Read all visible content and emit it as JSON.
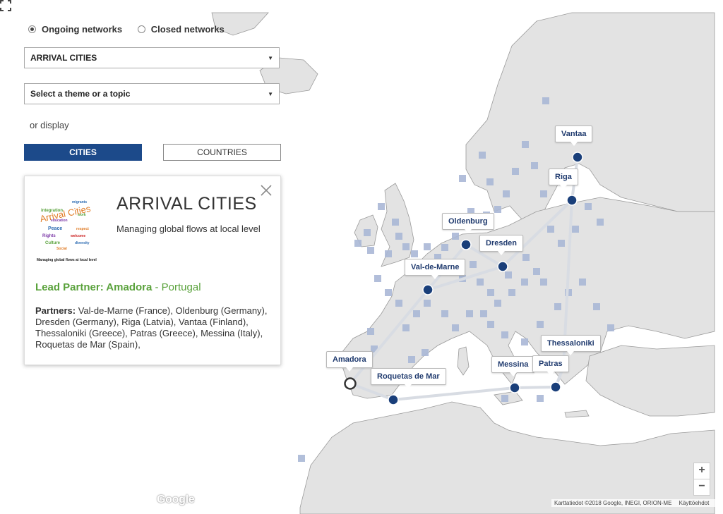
{
  "filters": {
    "network_options": [
      "Ongoing networks",
      "Closed networks"
    ],
    "selected_network": "Ongoing networks",
    "network_select_value": "ARRIVAL CITIES",
    "theme_select_placeholder": "Select a theme or a topic",
    "or_display": "or display",
    "cities_button": "CITIES",
    "countries_button": "COUNTRIES",
    "active_display": "CITIES"
  },
  "info_card": {
    "logo_text": "Arrival Cities",
    "logo_caption": "Managing global flows at local level",
    "title": "ARRIVAL CITIES",
    "subtitle": "Managing global flows at local level",
    "lead_label": "Lead Partner: Amadora",
    "lead_separator": "-",
    "lead_country": "Portugal",
    "partners_label": "Partners:",
    "partners_text": "Val-de-Marne (France), Oldenburg (Germany), Dresden (Germany), Riga (Latvia), Vantaa (Finland), Thessaloniki (Greece), Patras (Greece), Messina (Italy), Roquetas de Mar (Spain),"
  },
  "map": {
    "cities": [
      "Vantaa",
      "Riga",
      "Oldenburg",
      "Dresden",
      "Val-de-Marne",
      "Amadora",
      "Roquetas de Mar",
      "Messina",
      "Patras",
      "Thessaloniki"
    ],
    "lead_city": "Amadora",
    "zoom_in": "+",
    "zoom_out": "−",
    "google_logo": "Google",
    "attribution": "Karttatiedot ©2018 Google, INEGI, ORION-ME",
    "terms": "Käyttöehdot"
  },
  "colors": {
    "accent": "#1c4a8a",
    "lead_green": "#5aa23c",
    "marker": "#1a3f7a",
    "land": "#e3e3e3",
    "sea": "#ffffff",
    "network_line": "#d8dce3",
    "other_network_marker": "#aab8d6"
  },
  "icons": [
    "fullscreen-icon",
    "close-icon",
    "radio-icon",
    "caret-down-icon",
    "city-marker-icon"
  ]
}
